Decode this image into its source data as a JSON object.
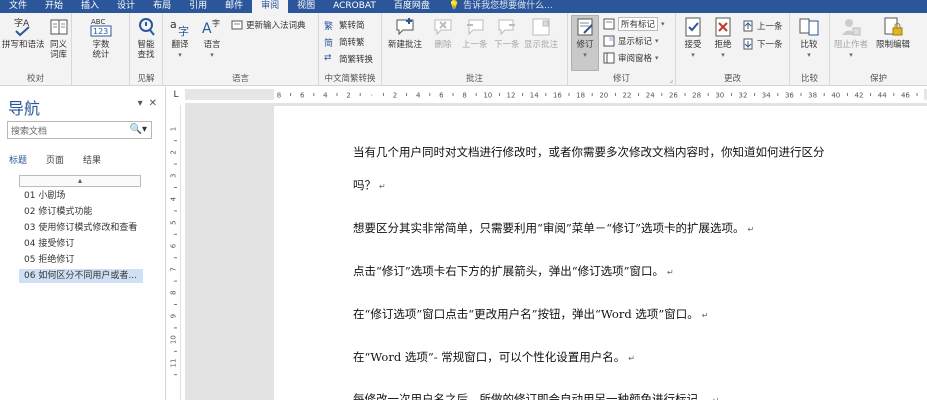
{
  "menubar": {
    "tabs": [
      "文件",
      "开始",
      "插入",
      "设计",
      "布局",
      "引用",
      "邮件",
      "审阅",
      "视图",
      "ACROBAT",
      "百度网盘"
    ],
    "active_tab": "审阅",
    "tell_me": "告诉我您想要做什么..."
  },
  "ribbon": {
    "proofing": {
      "label": "校对",
      "spelling": "拼写和语法",
      "thesaurus": "同义词库",
      "word_count": "字数统计"
    },
    "insights": {
      "label": "见解",
      "smart_lookup": "智能查找"
    },
    "language": {
      "label": "语言",
      "translate": "翻译",
      "language": "语言",
      "update_ime": "更新输入法词典"
    },
    "chinese": {
      "label": "中文简繁转换",
      "to_simplified": "繁转简",
      "to_traditional": "简转繁",
      "convert": "简繁转换"
    },
    "comments": {
      "label": "批注",
      "new": "新建批注",
      "delete": "删除",
      "previous": "上一条",
      "next": "下一条",
      "show": "显示批注"
    },
    "tracking": {
      "label": "修订",
      "track": "修订",
      "markup_select": "所有标记",
      "show_markup": "显示标记",
      "reviewing_pane": "审阅窗格"
    },
    "changes": {
      "label": "更改",
      "accept": "接受",
      "reject": "拒绝",
      "previous": "上一条",
      "next": "下一条"
    },
    "compare": {
      "label": "比较",
      "compare": "比较"
    },
    "protect": {
      "label": "保护",
      "block_authors": "阻止作者",
      "restrict": "限制编辑"
    }
  },
  "nav": {
    "title": "导航",
    "search_placeholder": "搜索文档",
    "tabs": [
      "标题",
      "页面",
      "结果"
    ],
    "headings": [
      "01 小剧场",
      "02 修订模式功能",
      "03 使用修订模式修改和查看",
      "04 接受修订",
      "05 拒绝修订",
      "06 如何区分不同用户或者..."
    ]
  },
  "ruler": {
    "corner": "L",
    "h_numbers": [
      "8",
      "6",
      "4",
      "2",
      "",
      "2",
      "4",
      "6",
      "8",
      "10",
      "12",
      "14",
      "16",
      "18",
      "20",
      "22",
      "24",
      "26",
      "28",
      "30",
      "32",
      "34",
      "36",
      "38",
      "40",
      "42",
      "44",
      "46"
    ],
    "v_numbers": [
      "1",
      "2",
      "3",
      "4",
      "5",
      "6",
      "7",
      "8",
      "9",
      "10",
      "11"
    ]
  },
  "document": {
    "paragraphs": [
      "当有几个用户同时对文档进行修改时，或者你需要多次修改文档内容时，你知道如何进行区分",
      "吗？",
      "想要区分其实非常简单，只需要利用“审阅”菜单－“修订”选项卡的扩展选项。",
      "点击“修订”选项卡右下方的扩展箭头，弹出“修订选项”窗口。",
      "在“修订选项”窗口点击“更改用户名”按钮，弹出“Word 选项”窗口。",
      "在“Word 选项”- 常规窗口，可以个性化设置用户名。",
      "每修改一次用户名之后，所做的修订即会自动用另一种颜色进行标记。"
    ],
    "paragraph_mark": "↵"
  },
  "colors": {
    "accent": "#2b579a",
    "ribbon_bg": "#f3f3f3",
    "doc_bg": "#e3e3e3",
    "selected_heading": "#cfe0f5"
  }
}
